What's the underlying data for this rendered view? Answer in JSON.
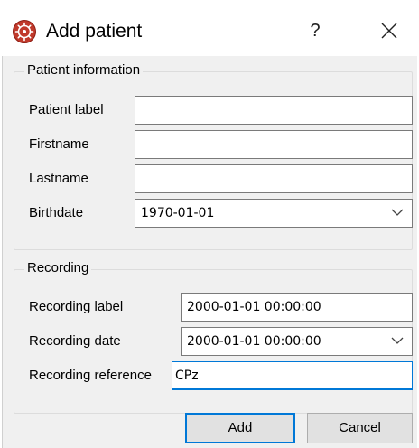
{
  "window": {
    "title": "Add patient",
    "help_label": "?"
  },
  "patient_group": {
    "title": "Patient information",
    "patient_label_label": "Patient label",
    "patient_label_value": "",
    "firstname_label": "Firstname",
    "firstname_value": "",
    "lastname_label": "Lastname",
    "lastname_value": "",
    "birthdate_label": "Birthdate",
    "birthdate_value": "1970-01-01"
  },
  "recording_group": {
    "title": "Recording",
    "recording_label_label": "Recording label",
    "recording_label_value": "2000-01-01 00:00:00",
    "recording_date_label": "Recording date",
    "recording_date_value": "2000-01-01 00:00:00",
    "recording_reference_label": "Recording reference",
    "recording_reference_value": "CPz"
  },
  "buttons": {
    "add": "Add",
    "cancel": "Cancel"
  },
  "colors": {
    "accent": "#0078d7",
    "dialog_background": "#f0f0f0",
    "app_icon": "#c0392b"
  },
  "icons": {
    "app": "eeg-head-icon",
    "close": "close-icon",
    "dropdown": "chevron-down-icon"
  }
}
